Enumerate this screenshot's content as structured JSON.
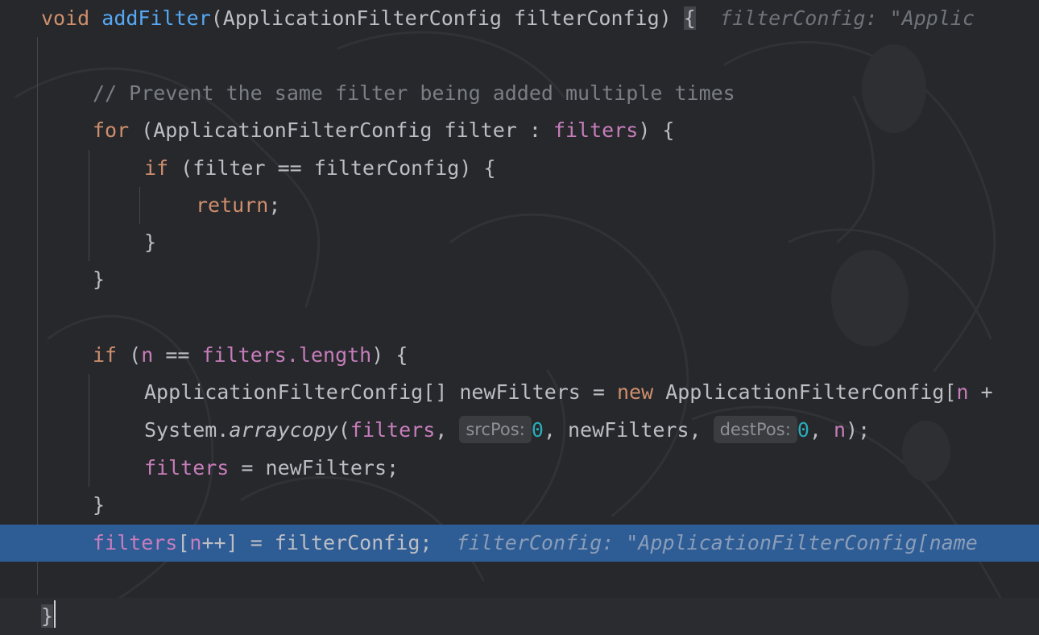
{
  "editor": {
    "language": "Java",
    "selection_color": "#2e5c95",
    "lines": {
      "l1": {
        "kw_void": "void",
        "fn_name": "addFilter",
        "params": "(ApplicationFilterConfig filterConfig) ",
        "brace": "{",
        "hint": "filterConfig: \"Applic"
      },
      "l3": {
        "comment": "// Prevent the same filter being added multiple times"
      },
      "l4": {
        "kw_for": "for",
        "part1": " (ApplicationFilterConfig filter : ",
        "field": "filters",
        "part2": ") {"
      },
      "l5": {
        "kw_if": "if",
        "rest": " (filter == filterConfig) {"
      },
      "l6": {
        "kw_return": "return",
        "semi": ";"
      },
      "l7": {
        "brace": "}"
      },
      "l8": {
        "brace": "}"
      },
      "l10": {
        "kw_if": "if",
        "open": " (",
        "n": "n",
        "eq": " == ",
        "field": "filters.length",
        "close": ") {"
      },
      "l11": {
        "part1": "ApplicationFilterConfig[] newFilters = ",
        "kw_new": "new",
        "part2": " ApplicationFilterConfig[",
        "n": "n",
        "tail": " +"
      },
      "l12": {
        "system": "System.",
        "method": "arraycopy",
        "open": "(",
        "field": "filters",
        "comma1": ", ",
        "hint_src": "srcPos:",
        "zero1": "0",
        "mid": ", newFilters, ",
        "hint_dest": "destPos:",
        "zero2": "0",
        "comma2": ", ",
        "n": "n",
        "close": ");"
      },
      "l13": {
        "field": "filters",
        "rest": " = newFilters;"
      },
      "l14": {
        "brace": "}"
      },
      "l15": {
        "field": "filters",
        "open": "[",
        "n": "n",
        "rest": "++] = filterConfig;",
        "hint": "filterConfig: \"ApplicationFilterConfig[name"
      },
      "l17": {
        "brace": "}"
      }
    }
  }
}
